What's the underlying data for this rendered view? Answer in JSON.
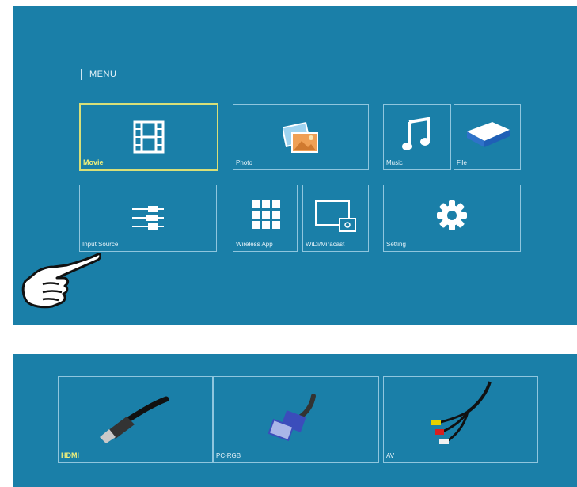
{
  "menu": {
    "title": "MENU",
    "tiles": [
      {
        "label": "Movie",
        "icon": "film-icon",
        "selected": true
      },
      {
        "label": "Photo",
        "icon": "photo-icon"
      },
      {
        "label": "Music",
        "icon": "music-note-icon"
      },
      {
        "label": "File",
        "icon": "book-icon"
      },
      {
        "label": "Input Source",
        "icon": "cable-plug-icon"
      },
      {
        "label": "Wireless App",
        "icon": "app-grid-icon"
      },
      {
        "label": "WiDi/Miracast",
        "icon": "screen-mirroring-icon"
      },
      {
        "label": "Setting",
        "icon": "gear-icon"
      }
    ]
  },
  "sources": {
    "tiles": [
      {
        "label": "HDMI",
        "icon": "hdmi-cable-icon",
        "selected": true
      },
      {
        "label": "PC-RGB",
        "icon": "vga-cable-icon"
      },
      {
        "label": "AV",
        "icon": "av-cable-icon"
      }
    ]
  },
  "colors": {
    "background": "#1a7fa8",
    "tile_border": "#8fc6de",
    "selected_border": "#d8df78",
    "selected_text": "#f1f07a"
  },
  "pointer": {
    "icon": "pointing-hand-icon"
  }
}
